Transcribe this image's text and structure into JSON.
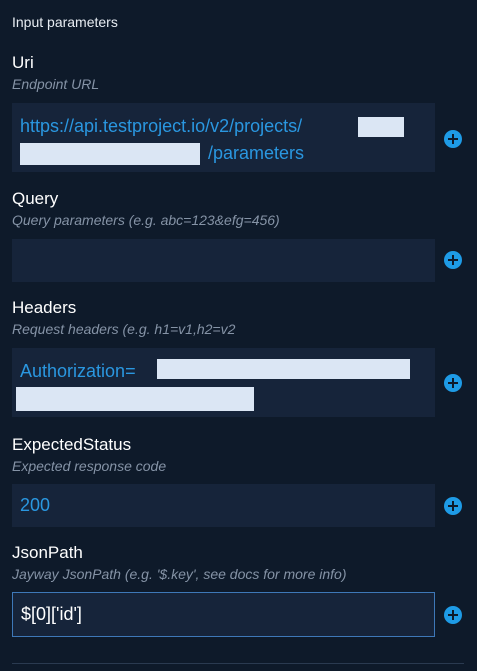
{
  "section": {
    "title": "Input parameters"
  },
  "params": [
    {
      "name": "Uri",
      "description": "Endpoint URL",
      "value_line1": "https://api.testproject.io/v2/projects/",
      "value_line2": "/parameters"
    },
    {
      "name": "Query",
      "description": "Query parameters (e.g. abc=123&efg=456)",
      "value": ""
    },
    {
      "name": "Headers",
      "description": "Request headers (e.g. h1=v1,h2=v2",
      "value": "Authorization="
    },
    {
      "name": "ExpectedStatus",
      "description": "Expected response code",
      "value": "200"
    },
    {
      "name": "JsonPath",
      "description": "Jayway JsonPath (e.g. '$.key', see docs for more info)",
      "value": "$[0]['id']"
    }
  ],
  "icons": {
    "add": "plus-circle-icon"
  },
  "colors": {
    "background": "#0e1a2a",
    "field_background": "#16243a",
    "accent": "#2a97e0",
    "focus_border": "#3e78b8"
  }
}
